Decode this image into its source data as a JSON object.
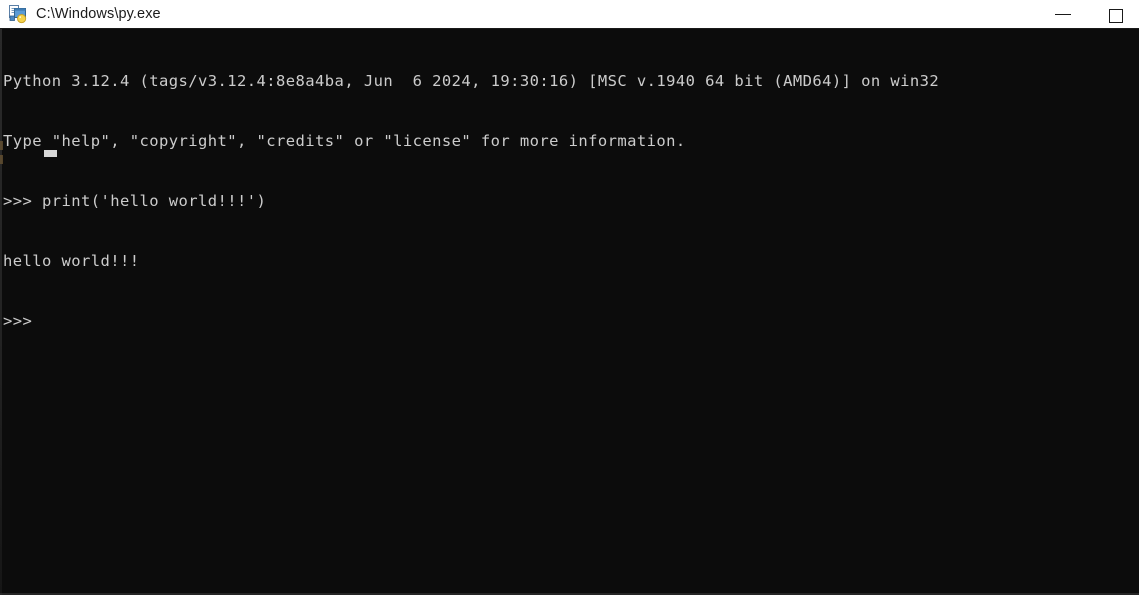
{
  "window": {
    "title": "C:\\Windows\\py.exe",
    "icon": "python-launcher-icon",
    "background_color": "#0c0c0c",
    "titlebar_color": "#ffffff",
    "text_color": "#cccccc"
  },
  "titlebar_buttons": {
    "minimize_label": "—",
    "minimize_name": "minimize-button",
    "maximize_label": "☐",
    "maximize_name": "maximize-button"
  },
  "console": {
    "lines": [
      "Python 3.12.4 (tags/v3.12.4:8e8a4ba, Jun  6 2024, 19:30:16) [MSC v.1940 64 bit (AMD64)] on win32",
      "Type \"help\", \"copyright\", \"credits\" or \"license\" for more information.",
      ">>> print('hello world!!!')",
      "hello world!!!",
      ">>> "
    ],
    "prompt_symbol": ">>> ",
    "command": "print('hello world!!!')",
    "output": "hello world!!!",
    "cursor": "_"
  }
}
